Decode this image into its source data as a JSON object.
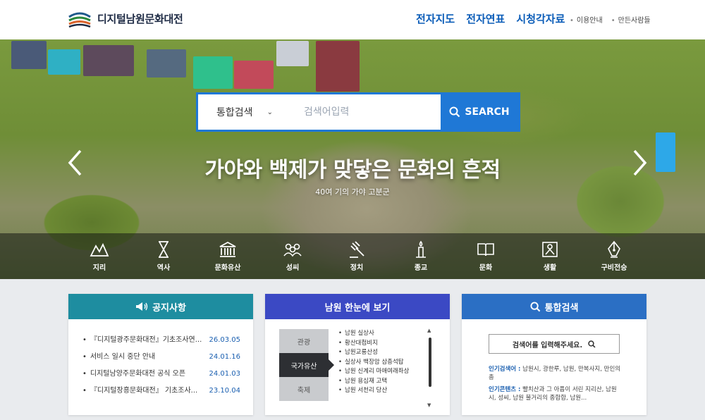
{
  "header": {
    "site_title": "디지털남원문화대전",
    "main_nav": [
      "전자지도",
      "전자연표",
      "시청각자료"
    ],
    "util_nav": [
      "이용안내",
      "만든사람들"
    ]
  },
  "hero": {
    "search": {
      "scope": "통합검색",
      "placeholder": "검색어입력",
      "button_label": "SEARCH"
    },
    "title": "가야와 백제가 맞닿은 문화의 흔적",
    "subtitle": "40여 기의 가야 고분군",
    "categories": [
      "지리",
      "역사",
      "문화유산",
      "성씨",
      "정치",
      "종교",
      "문화",
      "생활",
      "구비전승"
    ]
  },
  "notice": {
    "title": "공지사항",
    "items": [
      {
        "title": "『디지털광주문화대전』기초조사연...",
        "date": "26.03.05"
      },
      {
        "title": "서비스 일시 중단 안내",
        "date": "24.01.16"
      },
      {
        "title": "디지털남양주문화대전 공식 오픈",
        "date": "24.01.03"
      },
      {
        "title": "『디지털장흥문화대전』 기초조사...",
        "date": "23.10.04"
      }
    ]
  },
  "glance": {
    "title": "남원 한눈에 보기",
    "tabs": [
      "관광",
      "국가유산",
      "축제"
    ],
    "active_tab": "국가유산",
    "items": [
      "남원 실상사",
      "황산대첩비지",
      "남원교룡산성",
      "실상사 백장암 삼층석탑",
      "남원 신계리 마애여래좌상",
      "남원 용심재 고택",
      "남원 서천리 당산"
    ]
  },
  "total_search": {
    "title": "통합검색",
    "prompt": "검색어를 입력해주세요.",
    "popular_label": "인기검색어 :",
    "popular_text": "남원시, 광한루, 남원, 만복사지, 만인의",
    "popular_text_2": "총",
    "contents_label": "인기콘텐츠 :",
    "contents_text": "빨치산과 그 아픔이 서린 지리산, 남원",
    "contents_text_2": "시, 성씨, 남원 불거리의 종합합, 남원..."
  },
  "colors": {
    "primary_blue": "#0a5cb8",
    "search_blue": "#1f78d6",
    "notice_teal": "#1e8da0",
    "glance_indigo": "#3b49c4",
    "total_blue": "#2b6fc4"
  }
}
